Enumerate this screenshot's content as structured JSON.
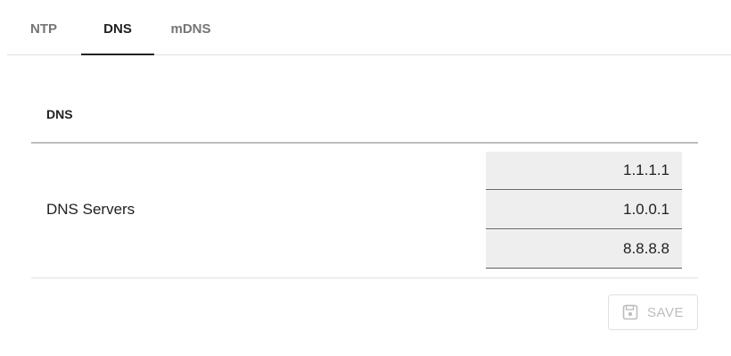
{
  "tabs": [
    {
      "label": "NTP",
      "active": false
    },
    {
      "label": "DNS",
      "active": true
    },
    {
      "label": "mDNS",
      "active": false
    }
  ],
  "section": {
    "title": "DNS"
  },
  "dns_servers": {
    "label": "DNS Servers",
    "values": [
      "1.1.1.1",
      "1.0.0.1",
      "8.8.8.8"
    ]
  },
  "actions": {
    "save_label": "SAVE",
    "save_icon": "floppy-disk-icon",
    "save_enabled": false
  },
  "colors": {
    "active_tab": "#212121",
    "inactive_tab": "#757575",
    "field_background": "#eeeeee",
    "disabled": "#bdbdbd"
  }
}
